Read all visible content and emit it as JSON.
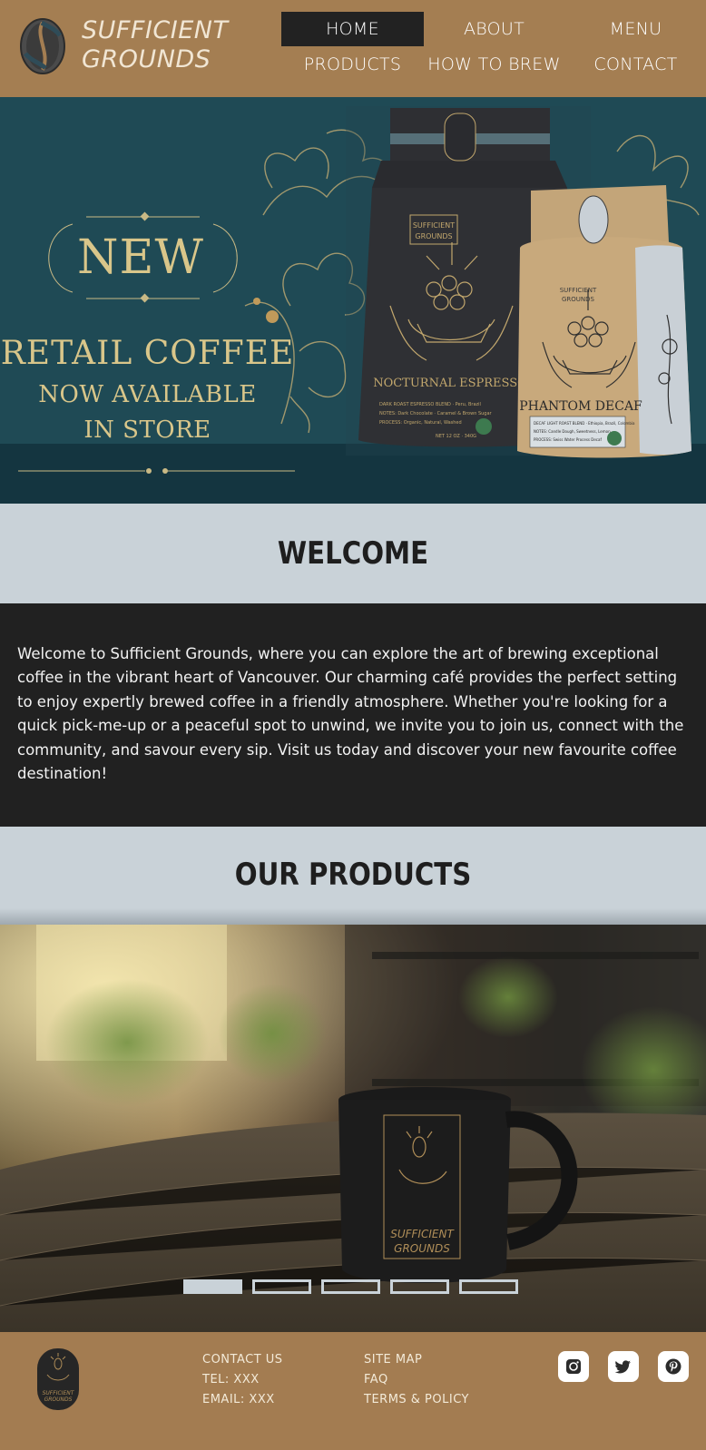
{
  "brand": {
    "name_line1": "SUFFICIENT",
    "name_line2": "GROUNDS"
  },
  "nav": {
    "items": [
      {
        "label": "HOME",
        "active": true
      },
      {
        "label": "ABOUT",
        "active": false
      },
      {
        "label": "MENU",
        "active": false
      },
      {
        "label": "PRODUCTS",
        "active": false
      },
      {
        "label": "HOW TO BREW",
        "active": false
      },
      {
        "label": "CONTACT",
        "active": false
      }
    ]
  },
  "hero": {
    "badge": "NEW",
    "headline": "RETAIL COFFEE",
    "subline1": "NOW AVAILABLE",
    "subline2": "IN STORE",
    "bag_dark": {
      "brand_line1": "SUFFICIENT",
      "brand_line2": "GROUNDS",
      "name": "NOCTURNAL ESPRESSO",
      "details": [
        "DARK ROAST ESPRESSO BLEND · Peru, Brazil",
        "NOTES: Dark Chocolate · Caramel & Brown Sugar",
        "PROCESS: Organic, Natural, Washed"
      ],
      "weight": "NET 12 OZ · 340G"
    },
    "bag_light": {
      "brand_line1": "SUFFICIENT",
      "brand_line2": "GROUNDS",
      "name": "PHANTOM DECAF",
      "details": [
        "DECAF LIGHT ROAST BLEND · Ethiopia, Brazil, Colombia",
        "NOTES: Candle Dough, Sweetness, Lemon",
        "PROCESS: Swiss Water Process Decaf"
      ]
    },
    "colors": {
      "accent": "#d9c68a",
      "bg": "#1f4a55"
    }
  },
  "welcome": {
    "title": "WELCOME",
    "text": "Welcome to Sufficient Grounds, where you can explore the art of brewing exceptional coffee in the vibrant heart of Vancouver. Our charming café provides the perfect setting to enjoy expertly brewed coffee in a friendly atmosphere. Whether you're looking for a quick pick-me-up or a peaceful spot to unwind, we invite you to join us, connect with the community, and savour every sip. Visit us today and discover your new favourite coffee destination!"
  },
  "products": {
    "title": "OUR PRODUCTS",
    "slide": {
      "mug_brand_line1": "SUFFICIENT",
      "mug_brand_line2": "GROUNDS"
    },
    "slides_count": 5,
    "active_slide": 1
  },
  "footer": {
    "logo_line1": "SUFFICIENT",
    "logo_line2": "GROUNDS",
    "contact_title": "CONTACT US",
    "tel": "TEL: XXX",
    "email": "EMAIL: XXX",
    "site_map": "SITE MAP",
    "faq": "FAQ",
    "terms": "TERMS & POLICY",
    "social": [
      "instagram-icon",
      "twitter-icon",
      "pinterest-icon"
    ]
  },
  "colors": {
    "brown": "#a37c51",
    "dark": "#212121",
    "pale_blue": "#c9d2d8"
  }
}
